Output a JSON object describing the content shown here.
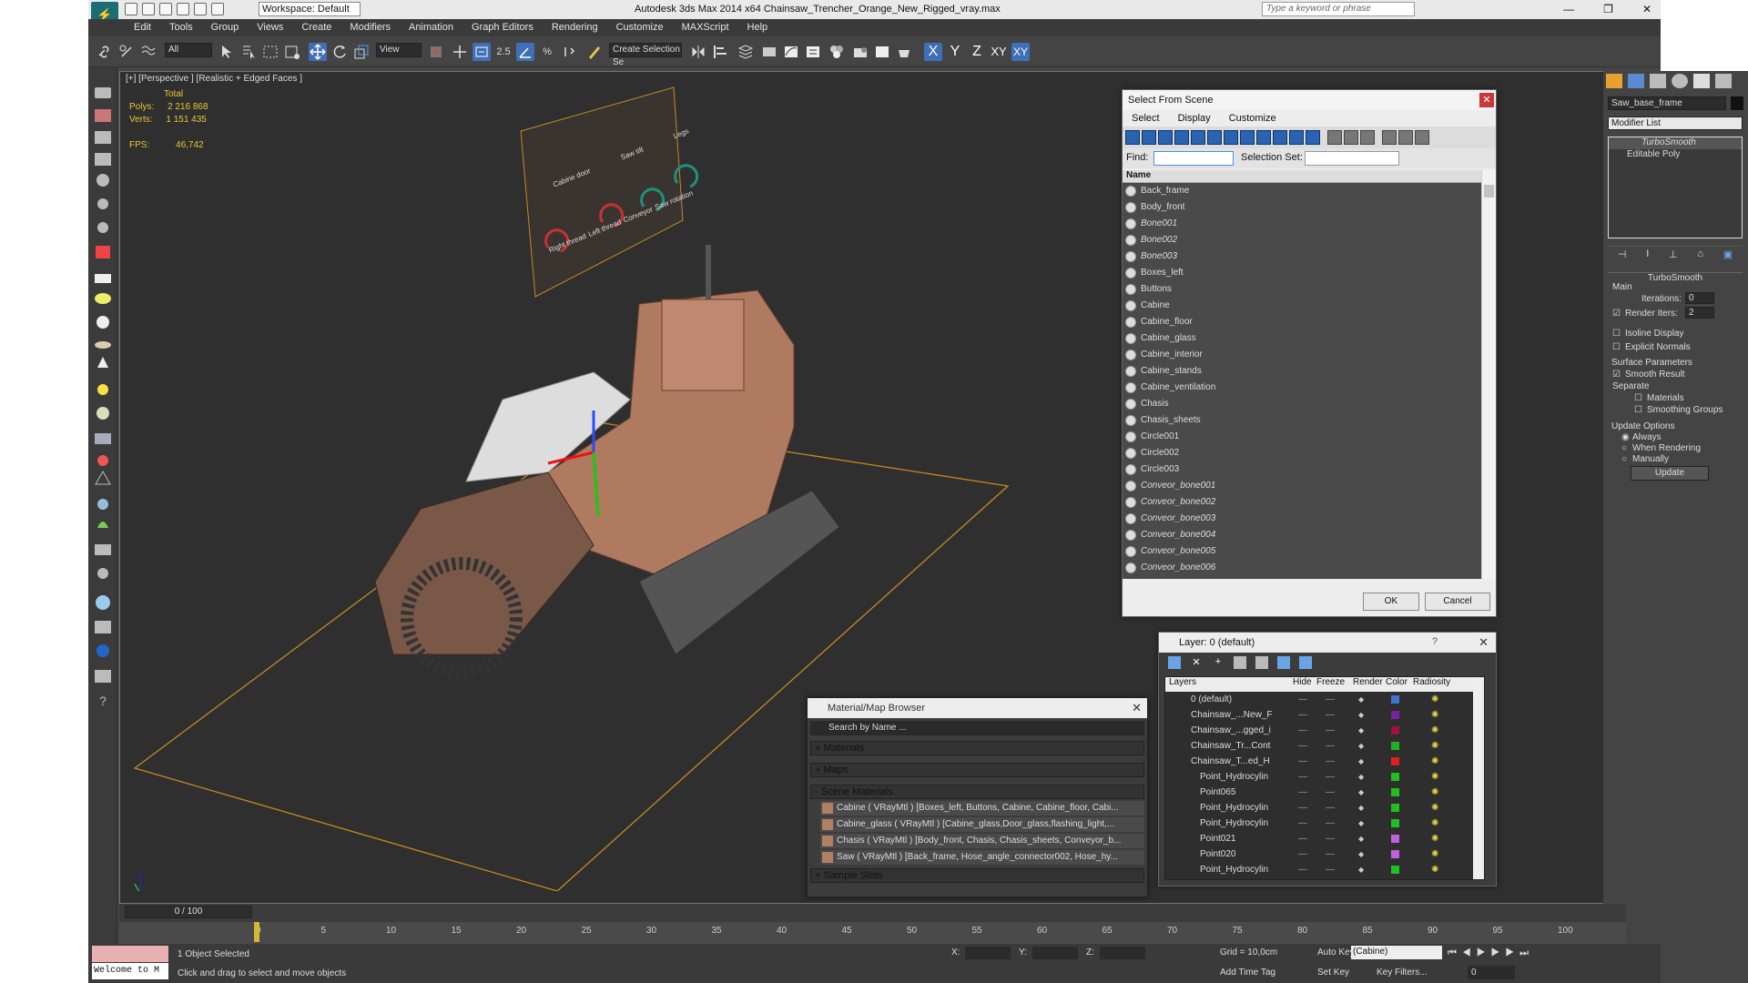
{
  "titlebar": {
    "workspace": "Workspace: Default",
    "title": "Autodesk 3ds Max  2014 x64      Chainsaw_Trencher_Orange_New_Rigged_vray.max",
    "search_placeholder": "Type a keyword or phrase"
  },
  "menu": [
    "Edit",
    "Tools",
    "Group",
    "Views",
    "Create",
    "Modifiers",
    "Animation",
    "Graph Editors",
    "Rendering",
    "Customize",
    "MAXScript",
    "Help"
  ],
  "toolbar": {
    "filter": "All",
    "refcoord": "View",
    "snap_value": "2.5",
    "named_selection": "Create Selection Se",
    "axes": [
      "X",
      "Y",
      "Z",
      "XY",
      "XY"
    ]
  },
  "viewport": {
    "label": "[+] [Perspective ] [Realistic + Edged Faces ]",
    "stats": {
      "total_label": "Total",
      "polys_label": "Polys:",
      "polys": "2 216 868",
      "verts_label": "Verts:",
      "verts": "1 151 435",
      "fps_label": "FPS:",
      "fps": "46,742"
    },
    "board_labels": [
      "Cabine door",
      "Saw tilt",
      "Legs",
      "Right thread",
      "Left thread",
      "Conveyor",
      "Saw rotation"
    ]
  },
  "select_from_scene": {
    "title": "Select From Scene",
    "menu": [
      "Select",
      "Display",
      "Customize"
    ],
    "find_label": "Find:",
    "selection_set_label": "Selection Set:",
    "column": "Name",
    "items": [
      {
        "name": "Back_frame",
        "italic": false
      },
      {
        "name": "Body_front",
        "italic": false
      },
      {
        "name": "Bone001",
        "italic": true
      },
      {
        "name": "Bone002",
        "italic": true
      },
      {
        "name": "Bone003",
        "italic": true
      },
      {
        "name": "Boxes_left",
        "italic": false
      },
      {
        "name": "Buttons",
        "italic": false
      },
      {
        "name": "Cabine",
        "italic": false
      },
      {
        "name": "Cabine_floor",
        "italic": false
      },
      {
        "name": "Cabine_glass",
        "italic": false
      },
      {
        "name": "Cabine_interior",
        "italic": false
      },
      {
        "name": "Cabine_stands",
        "italic": false
      },
      {
        "name": "Cabine_ventilation",
        "italic": false
      },
      {
        "name": "Chasis",
        "italic": false
      },
      {
        "name": "Chasis_sheets",
        "italic": false
      },
      {
        "name": "Circle001",
        "italic": false
      },
      {
        "name": "Circle002",
        "italic": false
      },
      {
        "name": "Circle003",
        "italic": false
      },
      {
        "name": "Conveor_bone001",
        "italic": true
      },
      {
        "name": "Conveor_bone002",
        "italic": true
      },
      {
        "name": "Conveor_bone003",
        "italic": true
      },
      {
        "name": "Conveor_bone004",
        "italic": true
      },
      {
        "name": "Conveor_bone005",
        "italic": true
      },
      {
        "name": "Conveor_bone006",
        "italic": true
      }
    ],
    "ok": "OK",
    "cancel": "Cancel"
  },
  "layer": {
    "title": "Layer: 0 (default)",
    "help": "?",
    "headers": [
      "Layers",
      "Hide",
      "Freeze",
      "Render",
      "Color",
      "Radiosity"
    ],
    "rows": [
      {
        "name": "0 (default)",
        "color": "#3a78d0"
      },
      {
        "name": "Chainsaw_...New_F",
        "color": "#7a20a0"
      },
      {
        "name": "Chainsaw_...gged_i",
        "color": "#a01040"
      },
      {
        "name": "Chainsaw_Tr...Cont",
        "color": "#20b020"
      },
      {
        "name": "Chainsaw_T...ed_H",
        "color": "#e02020"
      },
      {
        "name": "Point_Hydrocylin",
        "color": "#20c020"
      },
      {
        "name": "Point065",
        "color": "#20c020"
      },
      {
        "name": "Point_Hydrocylin",
        "color": "#20c020"
      },
      {
        "name": "Point_Hydrocylin",
        "color": "#20c020"
      },
      {
        "name": "Point021",
        "color": "#c060e0"
      },
      {
        "name": "Point020",
        "color": "#c060e0"
      },
      {
        "name": "Point_Hydrocylin",
        "color": "#20c020"
      }
    ]
  },
  "material_browser": {
    "title": "Material/Map Browser",
    "search": "Search by Name ...",
    "sections": [
      "+ Materials",
      "+ Maps",
      "- Scene Materials"
    ],
    "materials": [
      "Cabine  ( VRayMtl ) [Boxes_left, Buttons, Cabine, Cabine_floor, Cabi...",
      "Cabine_glass  ( VRayMtl ) [Cabine_glass,Door_glass,flashing_light,...",
      "Chasis  ( VRayMtl ) [Body_front, Chasis, Chasis_sheets, Conveyor_b...",
      "Saw  ( VRayMtl ) [Back_frame, Hose_angle_connector002, Hose_hy..."
    ],
    "sample_slots": "+ Sample Slots"
  },
  "command_panel": {
    "object_name": "Saw_base_frame",
    "modifier_list": "Modifier List",
    "stack": [
      "TurboSmooth",
      "Editable Poly"
    ],
    "rollout": "TurboSmooth",
    "main": "Main",
    "iterations_label": "Iterations:",
    "iterations": "0",
    "render_iters_label": "Render Iters:",
    "render_iters": "2",
    "isoline": "Isoline Display",
    "explicit": "Explicit Normals",
    "surface": "Surface Parameters",
    "smooth_result": "Smooth Result",
    "separate": "Separate",
    "materials": "Materials",
    "smoothing_groups": "Smoothing Groups",
    "update_options": "Update Options",
    "always": "Always",
    "when_rendering": "When Rendering",
    "manually": "Manually",
    "update": "Update"
  },
  "timeline": {
    "frame": "0 / 100",
    "ticks": [
      "0",
      "5",
      "10",
      "15",
      "20",
      "25",
      "30",
      "35",
      "40",
      "45",
      "50",
      "55",
      "60",
      "65",
      "70",
      "75",
      "80",
      "85",
      "90",
      "95",
      "100"
    ]
  },
  "status": {
    "selected": "1 Object Selected",
    "prompt": "Click and drag to select and move objects",
    "welcome": "Welcome to M",
    "x_label": "X:",
    "y_label": "Y:",
    "z_label": "Z:",
    "grid": "Grid = 10,0cm",
    "auto_key": "Auto Key",
    "key_set": "(Cabine)",
    "set_key": "Set Key",
    "key_filters": "Key Filters...",
    "add_time_tag": "Add Time Tag",
    "frame_num": "0"
  }
}
